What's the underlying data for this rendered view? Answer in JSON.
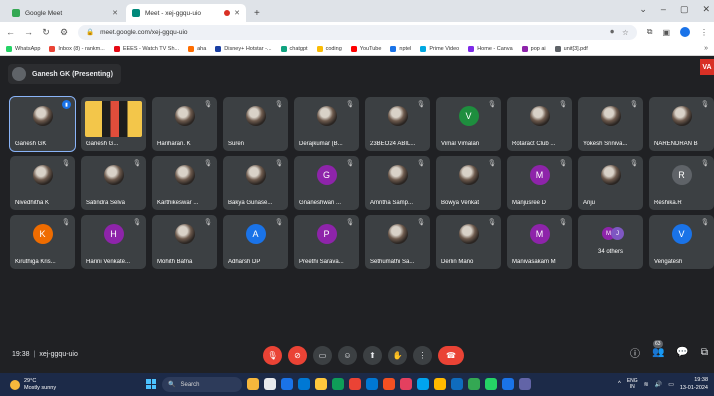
{
  "browser": {
    "tabs": [
      {
        "title": "Google Meet",
        "active": false,
        "favicon_color": "#34a853"
      },
      {
        "title": "Meet - xej-ggqu-uio",
        "active": true,
        "favicon_color": "#00897b"
      }
    ],
    "new_tab_symbol": "+",
    "window_controls": [
      "⌄",
      "–",
      "▢",
      "✕"
    ],
    "url": "meet.google.com/xej-ggqu-uio",
    "bookmarks": [
      {
        "label": "WhatsApp",
        "color": "#25d366"
      },
      {
        "label": "Inbox (8) - rankm...",
        "color": "#ea4335"
      },
      {
        "label": "EEES - Watch TV Sh...",
        "color": "#e50914"
      },
      {
        "label": "aha",
        "color": "#ff6d00"
      },
      {
        "label": "Disney+ Hotstar -...",
        "color": "#1a3fa3"
      },
      {
        "label": "chatgpt",
        "color": "#10a37f"
      },
      {
        "label": "coding",
        "color": "#fbbc04"
      },
      {
        "label": "YouTube",
        "color": "#ff0000"
      },
      {
        "label": "nptel",
        "color": "#1a73e8"
      },
      {
        "label": "Prime Video",
        "color": "#00a8e1"
      },
      {
        "label": "Home - Canva",
        "color": "#7d2ae8"
      },
      {
        "label": "pop ai",
        "color": "#8e24aa"
      },
      {
        "label": "unit[3].pdf",
        "color": "#5f6368"
      }
    ]
  },
  "meet": {
    "presenting_label": "Ganesh GK (Presenting)",
    "corner_badge": "VA",
    "participants": [
      {
        "name": "Ganesh GK",
        "kind": "photo",
        "highlight": true,
        "speaking": true
      },
      {
        "name": "Ganesh G...",
        "kind": "presentation"
      },
      {
        "name": "Hariharan. K",
        "kind": "photo"
      },
      {
        "name": "Suren",
        "kind": "photo"
      },
      {
        "name": "Derajkumar (B...",
        "kind": "photo"
      },
      {
        "name": "23BEO24 ABIL...",
        "kind": "photo"
      },
      {
        "name": "Vimal Vimalan",
        "kind": "letter",
        "letter": "V",
        "color": "#1e8e3e"
      },
      {
        "name": "Rotaract Club ...",
        "kind": "photo"
      },
      {
        "name": "Yokesh Sriniva...",
        "kind": "photo"
      },
      {
        "name": "NARENDRAN B",
        "kind": "photo"
      },
      {
        "name": "Nivedhitha K",
        "kind": "photo"
      },
      {
        "name": "Satindra Selva",
        "kind": "photo"
      },
      {
        "name": "Karthikeswar ...",
        "kind": "photo"
      },
      {
        "name": "Bakya Gunase...",
        "kind": "photo"
      },
      {
        "name": "Gnaneshwari ...",
        "kind": "letter",
        "letter": "G",
        "color": "#8e24aa"
      },
      {
        "name": "Amritha Samp...",
        "kind": "photo"
      },
      {
        "name": "Bowya Venkat",
        "kind": "photo"
      },
      {
        "name": "Manjusree D",
        "kind": "letter",
        "letter": "M",
        "color": "#8e24aa"
      },
      {
        "name": "Anju",
        "kind": "photo"
      },
      {
        "name": "Reshika.R",
        "kind": "letter",
        "letter": "R",
        "color": "#5f6368"
      },
      {
        "name": "Kiruthiga Kris...",
        "kind": "letter",
        "letter": "K",
        "color": "#ef6c00"
      },
      {
        "name": "Harini Venkate...",
        "kind": "letter",
        "letter": "H",
        "color": "#8e24aa"
      },
      {
        "name": "Mohith Bafna",
        "kind": "photo"
      },
      {
        "name": "Adharsh DP",
        "kind": "letter",
        "letter": "A",
        "color": "#1a73e8"
      },
      {
        "name": "Preethi Sarava...",
        "kind": "letter",
        "letter": "P",
        "color": "#8e24aa"
      },
      {
        "name": "Sethumathi Sa...",
        "kind": "photo"
      },
      {
        "name": "Derlin Mano",
        "kind": "photo"
      },
      {
        "name": "Manivasakam M",
        "kind": "letter",
        "letter": "M",
        "color": "#8e24aa"
      },
      {
        "name": "",
        "kind": "others",
        "others_label": "34 others",
        "letters": [
          "M",
          "J"
        ]
      },
      {
        "name": "Vengatesh",
        "kind": "letter",
        "letter": "V",
        "color": "#1a73e8"
      }
    ],
    "meeting_time": "19:38",
    "meeting_code": "xej-ggqu-uio",
    "participant_badge": "63"
  },
  "taskbar": {
    "weather_temp": "29°C",
    "weather_desc": "Mostly sunny",
    "search_placeholder": "Search",
    "language_top": "ENG",
    "language_bottom": "IN",
    "clock_time": "19:38",
    "clock_date": "13-01-2024",
    "app_colors": [
      "#f6b73c",
      "#e8eaed",
      "#1a73e8",
      "#0078d4",
      "#ffc83d",
      "#0f9d58",
      "#ea4335",
      "#0078d4",
      "#f25022",
      "#e4405f",
      "#00a4ef",
      "#ffb900",
      "#0f6cbd",
      "#34a853",
      "#25d366",
      "#1a73e8",
      "#6264a7"
    ]
  }
}
